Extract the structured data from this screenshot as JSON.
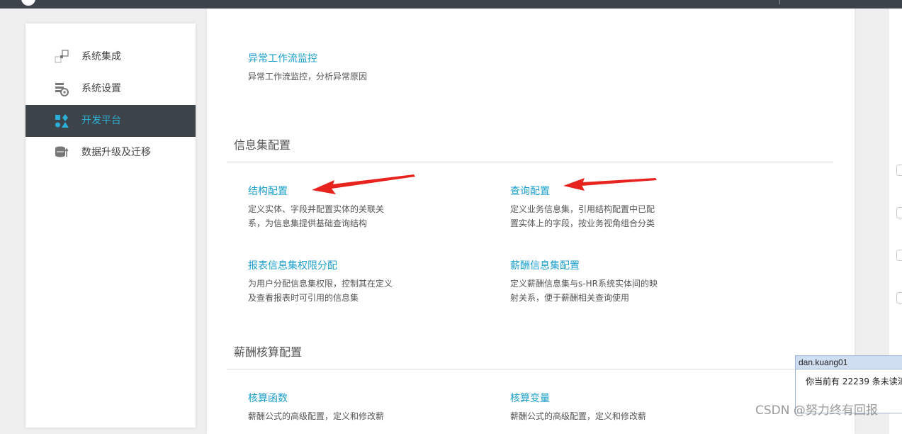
{
  "sidebar": {
    "items": [
      {
        "label": "系统集成",
        "icon": "system-integration-icon",
        "active": false
      },
      {
        "label": "系统设置",
        "icon": "system-settings-icon",
        "active": false
      },
      {
        "label": "开发平台",
        "icon": "dev-platform-icon",
        "active": true
      },
      {
        "label": "数据升级及迁移",
        "icon": "database-migration-icon",
        "active": false
      }
    ]
  },
  "main": {
    "top_item": {
      "title": "异常工作流监控",
      "desc": "异常工作流监控，分析异常原因"
    },
    "info_section": {
      "title": "信息集配置",
      "items": [
        {
          "title": "结构配置",
          "desc": "定义实体、字段并配置实体的关联关系，为信息集提供基础查询结构"
        },
        {
          "title": "查询配置",
          "desc": "定义业务信息集，引用结构配置中已配置实体上的字段，按业务视角组合分类"
        },
        {
          "title": "报表信息集权限分配",
          "desc": "为用户分配信息集权限，控制其在定义及查看报表时可引用的信息集"
        },
        {
          "title": "薪酬信息集配置",
          "desc": "定义薪酬信息集与s-HR系统实体间的映射关系，便于薪酬相关查询使用"
        }
      ]
    },
    "salary_section": {
      "title": "薪酬核算配置",
      "items": [
        {
          "title": "核算函数",
          "desc": "薪酬公式的高级配置，定义和修改薪"
        },
        {
          "title": "核算变量",
          "desc": "薪酬公式的高级配置，定义和修改薪"
        }
      ]
    }
  },
  "popup": {
    "user": "dan.kuang01",
    "message": "你当前有 22239 条未读消"
  },
  "watermark": "CSDN @努力终有回报",
  "colors": {
    "accent": "#1a9fca",
    "active_bg": "#3d4449",
    "active_text": "#2ab0d8",
    "arrow": "#e8231e"
  }
}
